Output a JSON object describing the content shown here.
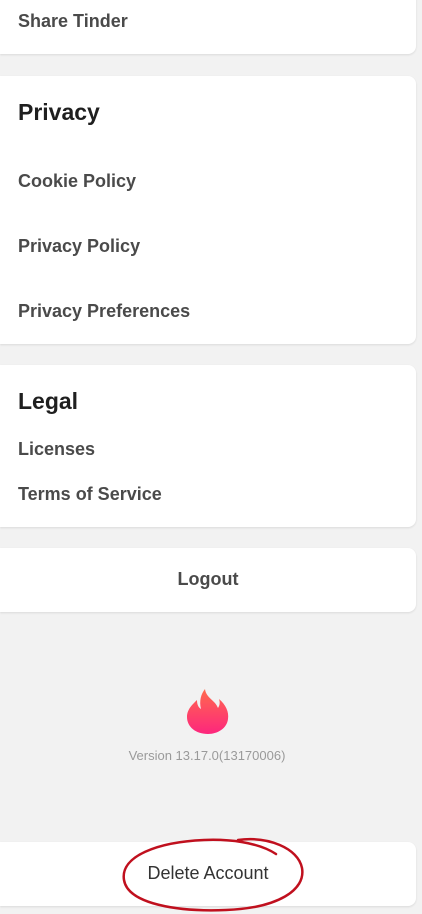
{
  "share": {
    "label": "Share Tinder"
  },
  "privacy": {
    "title": "Privacy",
    "items": [
      {
        "label": "Cookie Policy"
      },
      {
        "label": "Privacy Policy"
      },
      {
        "label": "Privacy Preferences"
      }
    ]
  },
  "legal": {
    "title": "Legal",
    "items": [
      {
        "label": "Licenses"
      },
      {
        "label": "Terms of Service"
      }
    ]
  },
  "logout": {
    "label": "Logout"
  },
  "brand": {
    "icon": "tinder-flame-icon",
    "accent": "#fe3c72",
    "version_text": "Version 13.17.0(13170006)"
  },
  "delete_account": {
    "label": "Delete Account",
    "annotation_color": "#c0101e"
  }
}
